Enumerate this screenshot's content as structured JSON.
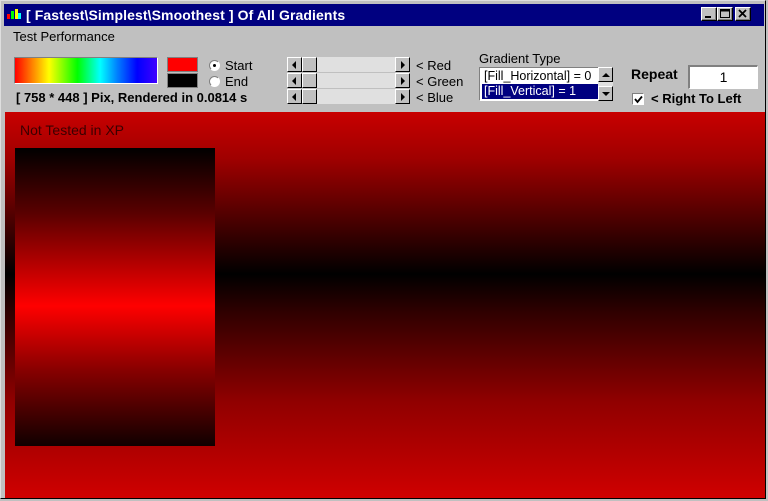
{
  "window": {
    "title": "[ Fastest\\Simplest\\Smoothest ]  Of All Gradients",
    "title_color": "#000080"
  },
  "menu": {
    "items": [
      "Test Performance"
    ]
  },
  "toolbar": {
    "status": "[ 758 * 448 ] Pix, Rendered in 0.0814 s",
    "start_color": "#ff0000",
    "end_color": "#000000",
    "radio_start": "Start",
    "radio_end": "End",
    "selected_radio": "Start",
    "sliders": [
      {
        "label": "< Red",
        "value": 0
      },
      {
        "label": "< Green",
        "value": 0
      },
      {
        "label": "< Blue",
        "value": 0
      }
    ],
    "gradient_type_label": "Gradient Type",
    "gradient_types": [
      "[Fill_Horizontal] = 0",
      "[Fill_Vertical] = 1"
    ],
    "gradient_selected": "[Fill_Vertical] = 1",
    "repeat_label": "Repeat",
    "repeat_value": "1",
    "right_to_left_label": "< Right To Left",
    "right_to_left_checked": true
  },
  "canvas": {
    "note": "Not Tested in XP"
  }
}
